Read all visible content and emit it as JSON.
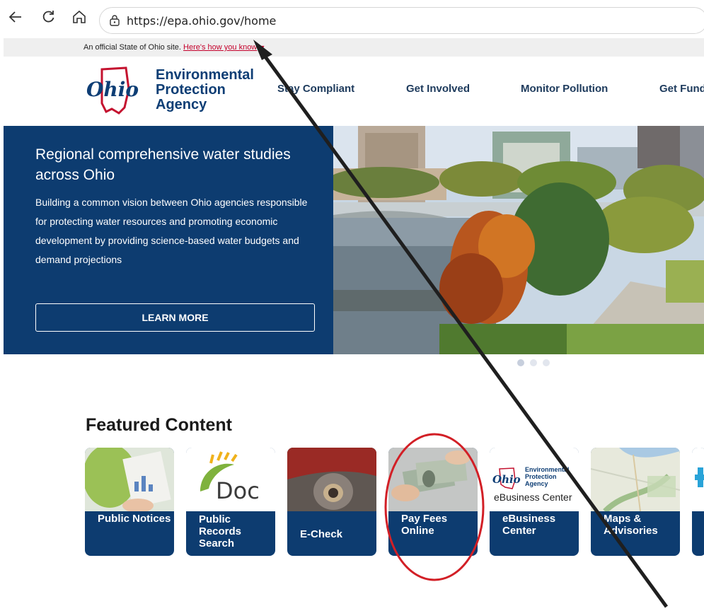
{
  "browser": {
    "url": "https://epa.ohio.gov/home",
    "back_icon": "arrow-left-icon",
    "reload_icon": "reload-icon",
    "home_icon": "home-icon",
    "lock_icon": "page-info-icon"
  },
  "gov_banner": {
    "text": "An official State of Ohio site.",
    "link": "Here's how you know"
  },
  "header": {
    "logo_line1": "Environmental",
    "logo_line2": "Protection",
    "logo_line3": "Agency",
    "logo_word": "Ohio",
    "nav": [
      "Stay Compliant",
      "Get Involved",
      "Monitor Pollution",
      "Get Fund"
    ]
  },
  "hero": {
    "title": "Regional comprehensive water studies across Ohio",
    "body": "Building a common vision between Ohio agencies responsible for protecting water resources and promoting economic development by providing science-based water budgets and demand projections",
    "button": "LEARN MORE",
    "slides": 3,
    "active_slide": 1
  },
  "featured": {
    "title": "Featured Content",
    "cards": [
      {
        "label": "Public Notices"
      },
      {
        "label": "Public Records Search",
        "logo_text": "Doc"
      },
      {
        "label": "E-Check"
      },
      {
        "label": "Pay Fees Online"
      },
      {
        "label": "eBusiness Center",
        "logo_text": "eBusiness Center"
      },
      {
        "label": "Maps & Advisories"
      }
    ]
  },
  "colors": {
    "brand_navy": "#0d3c70",
    "gov_link": "#c4002b",
    "annotation_red": "#d21f26",
    "annotation_arrow": "#1f1f1f"
  }
}
